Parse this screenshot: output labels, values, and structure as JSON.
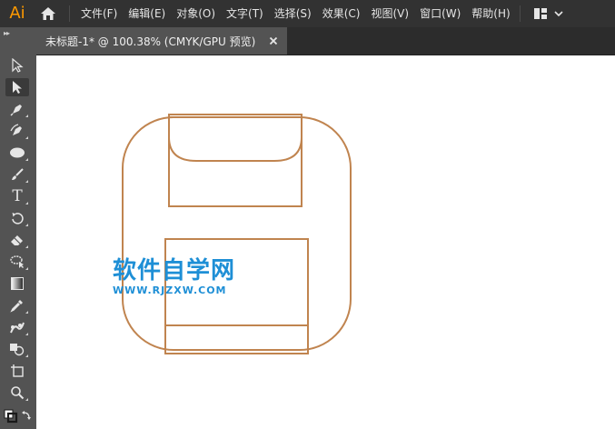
{
  "app": {
    "logo_text": "Ai",
    "brand_color": "#ff9a00"
  },
  "menubar": {
    "items": [
      {
        "label": "文件(F)"
      },
      {
        "label": "编辑(E)"
      },
      {
        "label": "对象(O)"
      },
      {
        "label": "文字(T)"
      },
      {
        "label": "选择(S)"
      },
      {
        "label": "效果(C)"
      },
      {
        "label": "视图(V)"
      },
      {
        "label": "窗口(W)"
      },
      {
        "label": "帮助(H)"
      }
    ],
    "home_icon": "home-icon",
    "workspace_icon": "workspace-layout-icon",
    "workspace_dropdown_icon": "chevron-down-icon"
  },
  "document_tab": {
    "title": "未标题-1* @ 100.38% (CMYK/GPU 预览)",
    "close_icon": "close-icon"
  },
  "toolbar": {
    "grip_text": "▸▸",
    "tools": [
      {
        "name": "selection-tool",
        "icon": "arrow-icon"
      },
      {
        "name": "direct-selection-tool",
        "icon": "direct-arrow-icon"
      },
      {
        "name": "pen-tool",
        "icon": "pen-icon"
      },
      {
        "name": "curvature-tool",
        "icon": "curvature-pen-icon"
      },
      {
        "name": "ellipse-tool",
        "icon": "ellipse-icon"
      },
      {
        "name": "paintbrush-tool",
        "icon": "brush-icon"
      },
      {
        "name": "type-tool",
        "icon": "type-icon",
        "glyph": "T"
      },
      {
        "name": "rotate-tool",
        "icon": "rotate-icon"
      },
      {
        "name": "eraser-tool",
        "icon": "eraser-icon"
      },
      {
        "name": "lasso-tool",
        "icon": "lasso-icon"
      },
      {
        "name": "gradient-tool",
        "icon": "gradient-icon"
      },
      {
        "name": "eyedropper-tool",
        "icon": "eyedropper-icon"
      },
      {
        "name": "puppet-warp-tool",
        "icon": "puppet-warp-icon"
      },
      {
        "name": "shape-builder-tool",
        "icon": "shape-builder-icon"
      },
      {
        "name": "artboard-tool",
        "icon": "artboard-icon"
      },
      {
        "name": "zoom-tool",
        "icon": "magnifier-icon"
      },
      {
        "name": "fill-stroke-swatch",
        "icon": "fill-stroke-icon"
      }
    ]
  },
  "artwork": {
    "stroke_color": "#c0844f"
  },
  "watermark": {
    "title": "软件自学网",
    "url": "WWW.RJZXW.COM",
    "color": "#1e8fd6"
  }
}
